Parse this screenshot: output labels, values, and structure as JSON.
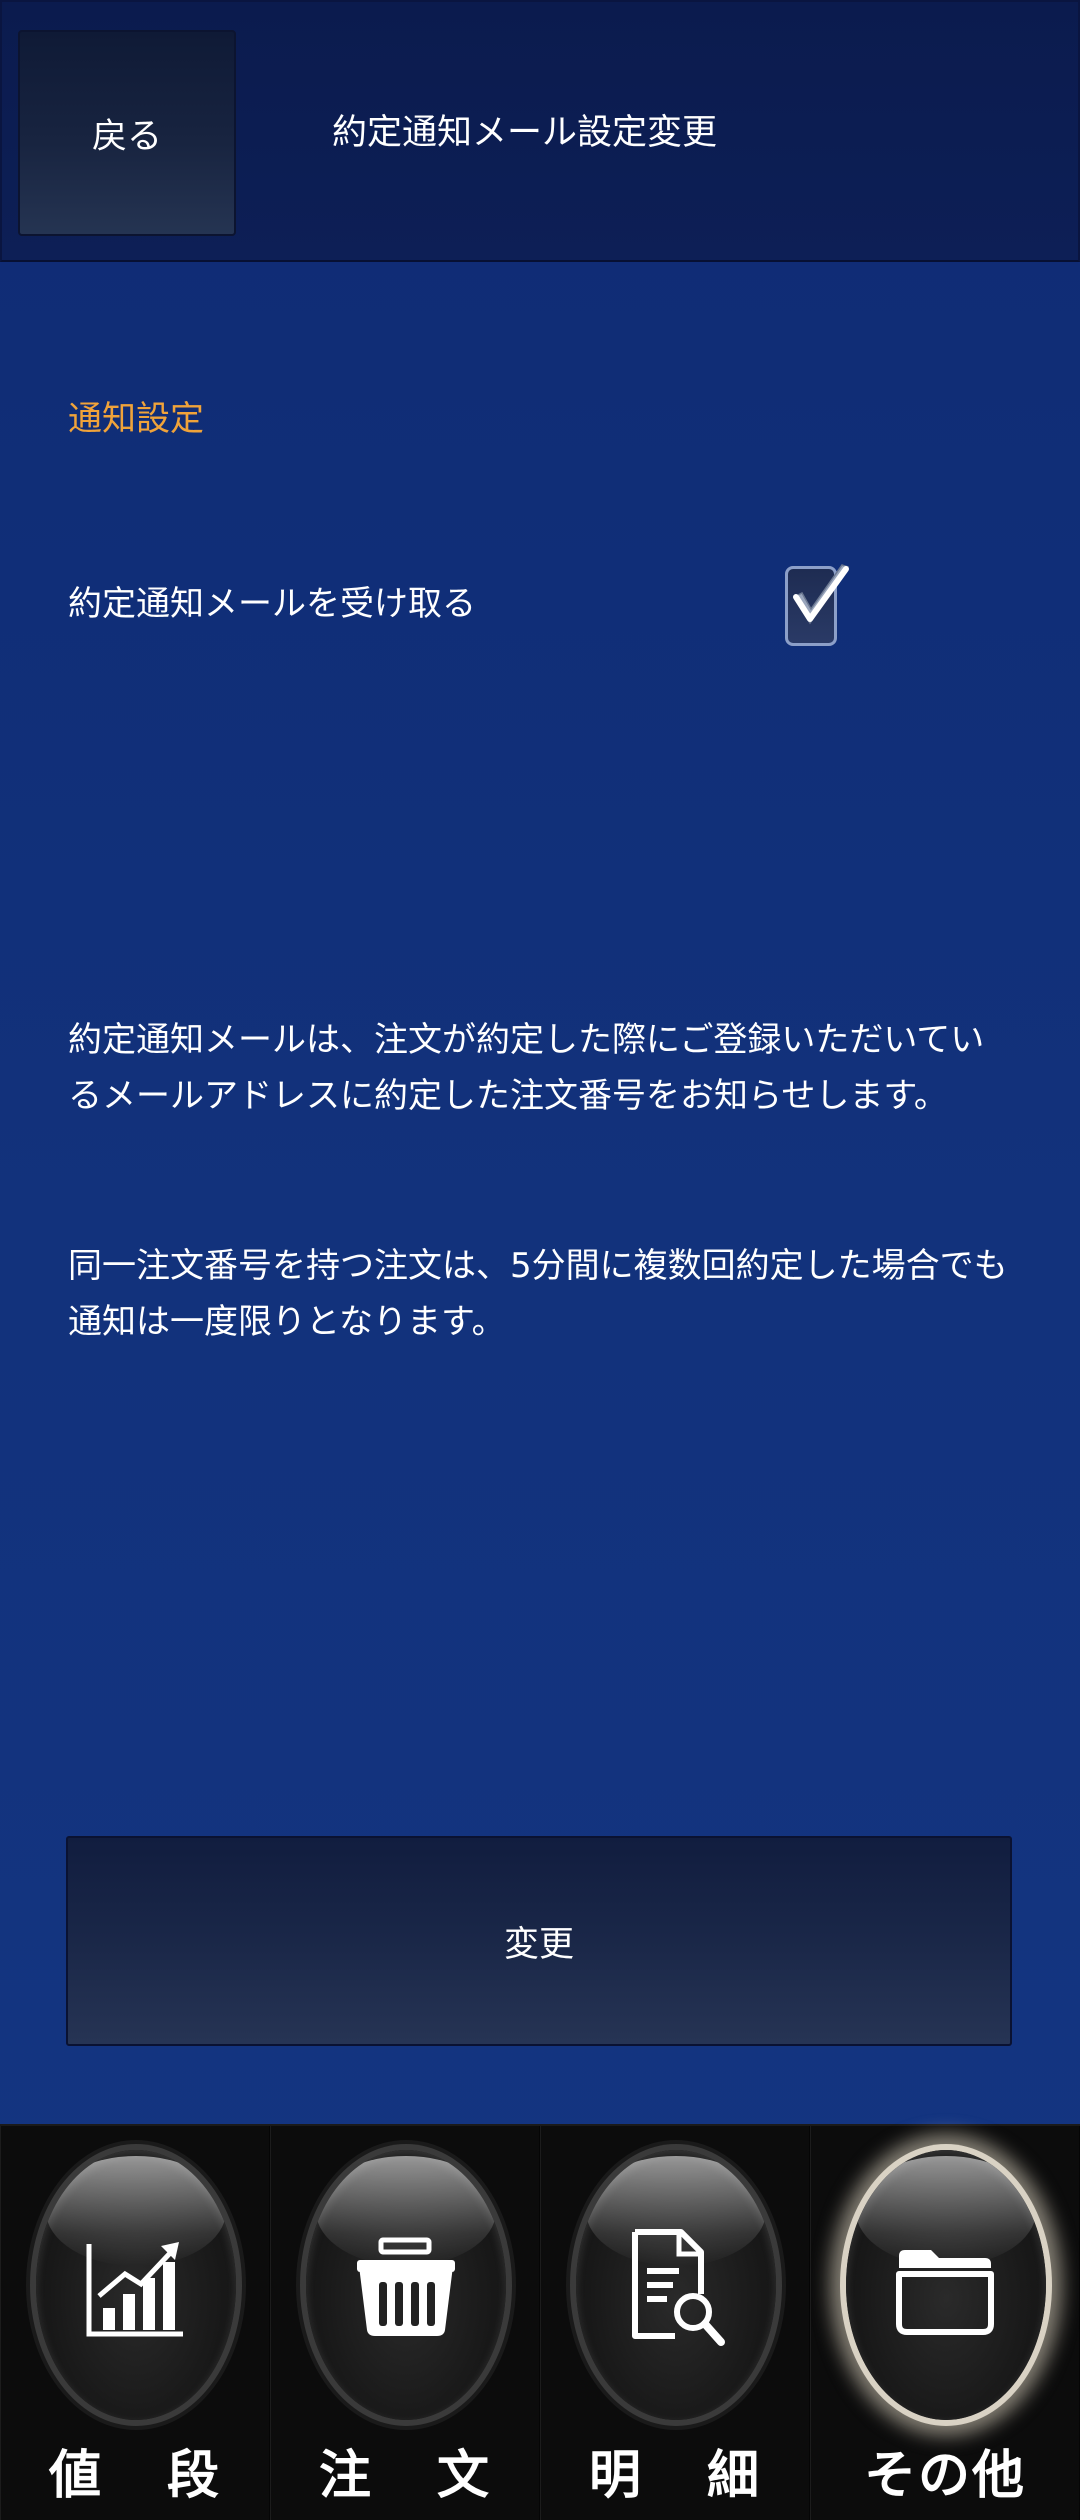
{
  "header": {
    "back_label": "戻る",
    "title": "約定通知メール設定変更"
  },
  "settings": {
    "section_title": "通知設定",
    "receive_label": "約定通知メールを受け取る",
    "receive_checked": true
  },
  "description": {
    "paragraph1": "約定通知メールは、注文が約定した際にご登録いただいているメールアドレスに約定した注文番号をお知らせします。",
    "paragraph2": "同一注文番号を持つ注文は、5分間に複数回約定した場合でも通知は一度限りとなります。"
  },
  "actions": {
    "submit_label": "変更"
  },
  "tabbar": {
    "tabs": [
      {
        "chars": [
          "値",
          "段"
        ],
        "icon": "chart-icon",
        "active": false
      },
      {
        "chars": [
          "注",
          "文"
        ],
        "icon": "basket-icon",
        "active": false
      },
      {
        "chars": [
          "明",
          "細"
        ],
        "icon": "document-search-icon",
        "active": false
      },
      {
        "label": "その他",
        "icon": "folder-icon",
        "active": true
      }
    ]
  },
  "colors": {
    "background": "#12327c",
    "header": "#0c1e54",
    "section_title": "#f0a33a",
    "tabbar": "#0c0c0c"
  }
}
